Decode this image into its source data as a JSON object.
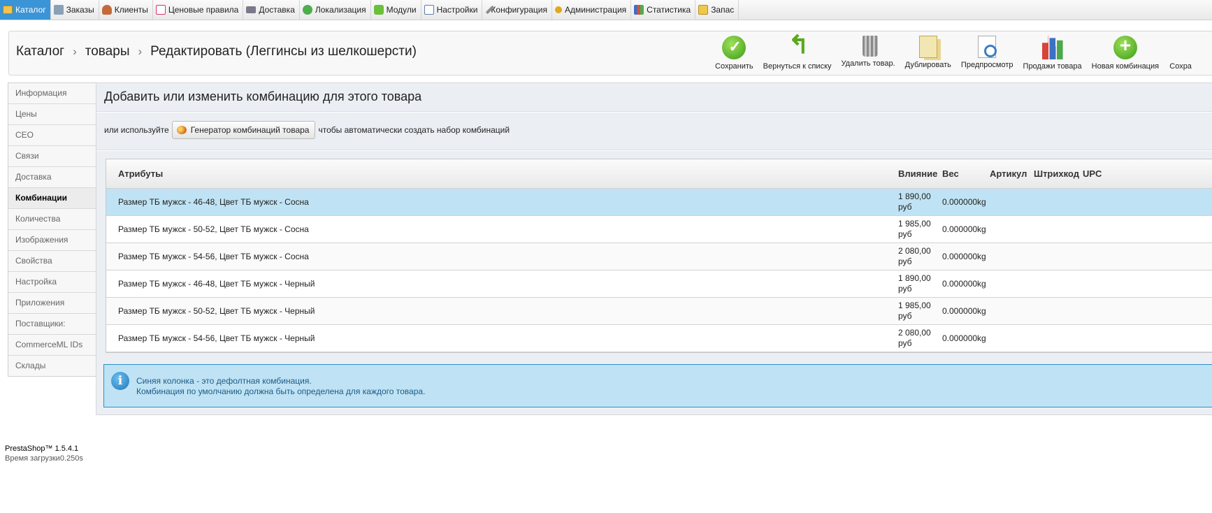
{
  "topmenu": [
    {
      "label": "Каталог",
      "icon": "folder-icon",
      "active": true
    },
    {
      "label": "Заказы",
      "icon": "orders-icon"
    },
    {
      "label": "Клиенты",
      "icon": "customers-icon"
    },
    {
      "label": "Ценовые правила",
      "icon": "price-rules-icon"
    },
    {
      "label": "Доставка",
      "icon": "truck-icon"
    },
    {
      "label": "Локализация",
      "icon": "globe-icon"
    },
    {
      "label": "Модули",
      "icon": "puzzle-icon"
    },
    {
      "label": "Настройки",
      "icon": "settings-icon"
    },
    {
      "label": "Конфигурация",
      "icon": "wrench-icon"
    },
    {
      "label": "Администрация",
      "icon": "key-icon"
    },
    {
      "label": "Статистика",
      "icon": "stats-icon"
    },
    {
      "label": "Запас",
      "icon": "stock-icon"
    }
  ],
  "breadcrumb": {
    "level1": "Каталог",
    "level2": "товары",
    "level3": "Редактировать (Леггинсы из шелкошерсти)"
  },
  "toolbar": {
    "save": "Сохранить",
    "back": "Вернуться к списку",
    "delete": "Удалить товар.",
    "duplicate": "Дублировать",
    "preview": "Предпросмотр",
    "sales": "Продажи товара",
    "new_combination": "Новая комбинация",
    "save_and_stay": "Сохра"
  },
  "tabs": [
    "Информация",
    "Цены",
    "СЕО",
    "Связи",
    "Доставка",
    "Комбинации",
    "Количества",
    "Изображения",
    "Свойства",
    "Настройка",
    "Приложения",
    "Поставщики:",
    "CommerceML IDs",
    "Склады"
  ],
  "active_tab": "Комбинации",
  "content": {
    "title": "Добавить или изменить комбинацию для этого товара",
    "generator_prefix": "или используйте",
    "generator_button": "Генератор комбинаций товара",
    "generator_suffix": "чтобы автоматически создать набор комбинаций"
  },
  "table": {
    "headers": {
      "attributes": "Атрибуты",
      "impact": "Влияние",
      "weight": "Вес",
      "sku": "Артикул",
      "barcode": "Штрихкод",
      "upc": "UPC"
    },
    "rows": [
      {
        "attributes": "Размер ТБ мужск - 46-48, Цвет ТБ мужск - Сосна",
        "impact_1": "1 890,00",
        "impact_2": "руб",
        "weight": "0.000000kg",
        "default": true
      },
      {
        "attributes": "Размер ТБ мужск - 50-52, Цвет ТБ мужск - Сосна",
        "impact_1": "1 985,00",
        "impact_2": "руб",
        "weight": "0.000000kg"
      },
      {
        "attributes": "Размер ТБ мужск - 54-56, Цвет ТБ мужск - Сосна",
        "impact_1": "2 080,00",
        "impact_2": "руб",
        "weight": "0.000000kg"
      },
      {
        "attributes": "Размер ТБ мужск - 46-48, Цвет ТБ мужск - Черный",
        "impact_1": "1 890,00",
        "impact_2": "руб",
        "weight": "0.000000kg"
      },
      {
        "attributes": "Размер ТБ мужск - 50-52, Цвет ТБ мужск - Черный",
        "impact_1": "1 985,00",
        "impact_2": "руб",
        "weight": "0.000000kg"
      },
      {
        "attributes": "Размер ТБ мужск - 54-56, Цвет ТБ мужск - Черный",
        "impact_1": "2 080,00",
        "impact_2": "руб",
        "weight": "0.000000kg"
      }
    ]
  },
  "info": {
    "line1": "Синяя колонка - это дефолтная комбинация.",
    "line2": "Комбинация по умолчанию должна быть определена для каждого товара."
  },
  "footer": {
    "version": "PrestaShop™ 1.5.4.1",
    "load_time": "Время загрузки0.250s"
  },
  "colors": {
    "accent": "#3a94d6",
    "default_row": "#bfe3f4",
    "info_border": "#2e8ec6"
  }
}
